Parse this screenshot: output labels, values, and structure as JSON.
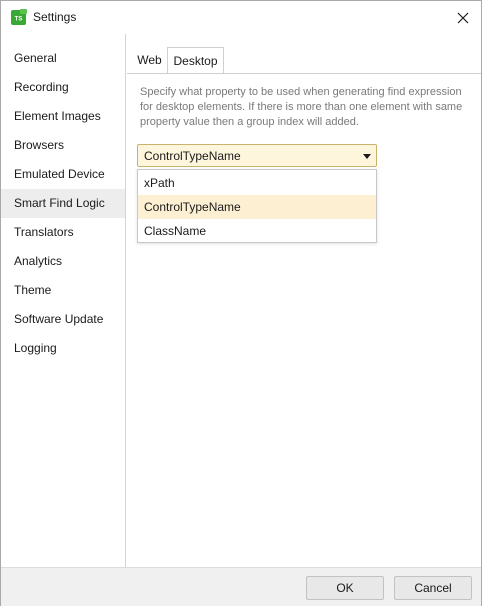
{
  "window": {
    "title": "Settings",
    "app_icon": "ts-logo-icon",
    "close_icon": "close-icon",
    "app_icon_text": "TS",
    "accent_color": "#3aa835"
  },
  "sidebar": {
    "items": [
      {
        "label": "General"
      },
      {
        "label": "Recording"
      },
      {
        "label": "Element Images"
      },
      {
        "label": "Browsers"
      },
      {
        "label": "Emulated Device"
      },
      {
        "label": "Smart Find Logic",
        "active": true
      },
      {
        "label": "Translators"
      },
      {
        "label": "Analytics"
      },
      {
        "label": "Theme"
      },
      {
        "label": "Software Update"
      },
      {
        "label": "Logging"
      }
    ]
  },
  "tabs": [
    {
      "label": "Web"
    },
    {
      "label": "Desktop",
      "active": true
    }
  ],
  "description": "Specify what property to be used when generating find expression for desktop elements. If there is more than one element with same property value then a group index will added.",
  "combo": {
    "value": "ControlTypeName",
    "arrow_icon": "dropdown-arrow-icon",
    "options": [
      {
        "label": "xPath"
      },
      {
        "label": "ControlTypeName",
        "selected": true
      },
      {
        "label": "ClassName"
      }
    ]
  },
  "footer": {
    "ok_label": "OK",
    "cancel_label": "Cancel"
  }
}
